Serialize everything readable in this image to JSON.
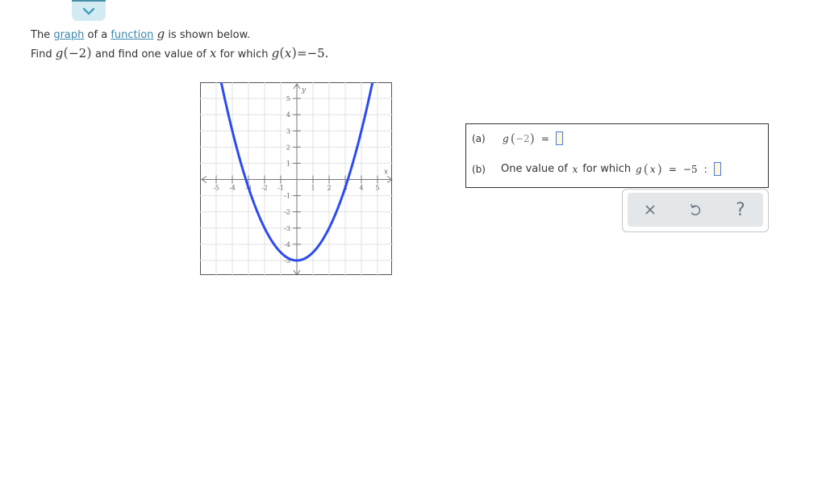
{
  "collapse_tab": {
    "icon": "chevron-down-icon",
    "color": "#4a9fc0"
  },
  "prompt": {
    "line1": {
      "the": "The",
      "graph_link": "graph",
      "of_a": "of a",
      "function_link": "function",
      "var": "g",
      "rest": "is shown below."
    },
    "line2": {
      "find": "Find",
      "func": "g",
      "arg": "−2",
      "middle": "and find one value of",
      "xvar": "x",
      "for_which": "for which",
      "func2": "g",
      "arg2": "x",
      "equals": "=",
      "rhs": "−5."
    }
  },
  "chart_data": {
    "type": "line",
    "title": "",
    "xlabel": "x",
    "ylabel": "y",
    "xlim": [
      -6,
      6
    ],
    "ylim": [
      -6,
      6
    ],
    "grid": true,
    "x_tick_labels": [
      "-5",
      "-4",
      "-3",
      "-2",
      "-1",
      "1",
      "2",
      "3",
      "4",
      "5"
    ],
    "y_tick_labels": [
      "5",
      "4",
      "3",
      "2",
      "1",
      "-1",
      "-2",
      "-3",
      "-4",
      "-5"
    ],
    "series": [
      {
        "name": "g",
        "color": "#2b4bf0",
        "function": "0.5*x^2 - 5",
        "vertex": [
          0,
          -5
        ],
        "x_intercepts": [
          -3.16,
          3.16
        ],
        "points": [
          [
            -4.69,
            6
          ],
          [
            -4,
            3
          ],
          [
            -3,
            -0.5
          ],
          [
            -2,
            -3
          ],
          [
            -1,
            -4.5
          ],
          [
            0,
            -5
          ],
          [
            1,
            -4.5
          ],
          [
            2,
            -3
          ],
          [
            3,
            -0.5
          ],
          [
            4,
            3
          ],
          [
            4.69,
            6
          ]
        ]
      }
    ]
  },
  "answers": {
    "a": {
      "label": "(a)",
      "func": "g",
      "arg": "−2",
      "equals": "=",
      "value": ""
    },
    "b": {
      "label": "(b)",
      "text": "One value of",
      "xvar": "x",
      "for_which": "for which",
      "func": "g",
      "arg": "x",
      "equals": "=",
      "rhs": "−5",
      "colon": ":",
      "value": ""
    }
  },
  "actions": {
    "clear": {
      "icon": "close-icon",
      "glyph": "✕"
    },
    "undo": {
      "icon": "undo-icon",
      "glyph": "↺"
    },
    "help": {
      "icon": "help-icon",
      "glyph": "?"
    }
  }
}
